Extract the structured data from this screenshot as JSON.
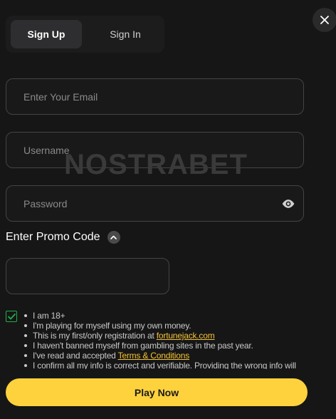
{
  "tabs": [
    {
      "label": "Sign Up",
      "active": true
    },
    {
      "label": "Sign In",
      "active": false
    }
  ],
  "fields": {
    "email": {
      "placeholder": "Enter Your Email",
      "value": ""
    },
    "username": {
      "placeholder": "Username",
      "value": ""
    },
    "password": {
      "placeholder": "Password",
      "value": ""
    },
    "promo": {
      "placeholder": "",
      "value": ""
    }
  },
  "watermark": {
    "text": "NOSTRABET"
  },
  "promo": {
    "label": "Enter Promo Code"
  },
  "terms": {
    "checked": true,
    "items": {
      "age": "I am 18+",
      "own_money": "I'm playing for myself using my own money.",
      "registration_prefix": "This is my first/only registration at ",
      "registration_link": "fortunejack.com",
      "not_banned": "I haven't banned myself from gambling sites in the past year.",
      "accepted_prefix": "I've read and accepted ",
      "accepted_link": "Terms & Conditions",
      "confirm": "I confirm all my info is correct and verifiable. Providing the wrong info will"
    }
  },
  "play_button": {
    "label": "Play Now"
  },
  "colors": {
    "background": "#161616",
    "accent": "#fdd23d",
    "link": "#f3c238",
    "check": "#21b04b"
  },
  "icons": [
    "close-icon",
    "eye-icon",
    "chevron-up-icon",
    "checkmark-icon"
  ]
}
